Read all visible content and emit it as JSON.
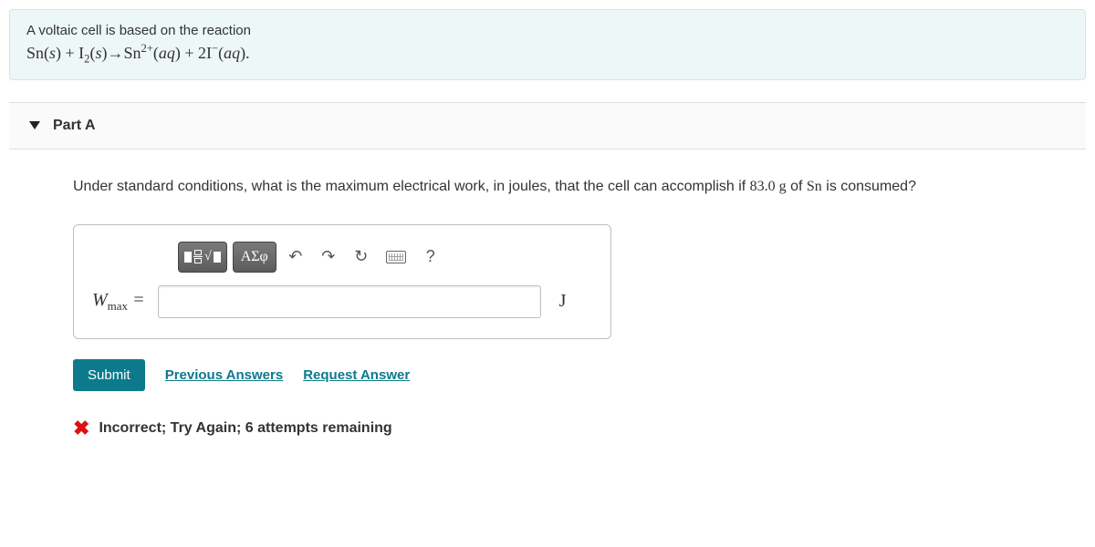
{
  "problem": {
    "intro": "A voltaic cell is based on the reaction",
    "reaction_html": "Sn(<span class='s'>s</span>) + I<sub>2</sub>(<span class='s'>s</span>)→Sn<sup>2+</sup>(<span class='s'>aq</span>) + 2I<sup>−</sup>(<span class='s'>aq</span>)."
  },
  "part": {
    "label": "Part A",
    "question_prefix": "Under standard conditions, what is the maximum electrical work, in joules, that the cell can accomplish if ",
    "question_value": "83.0 g",
    "question_mid": " of ",
    "question_species": "Sn",
    "question_suffix": " is consumed?"
  },
  "toolbar": {
    "template_label": "template",
    "symbols_label": "ΑΣφ",
    "undo": "↶",
    "redo": "↷",
    "reset": "↻",
    "help": "?"
  },
  "answer": {
    "variable": "W",
    "subscript": "max",
    "equals": " = ",
    "value": "",
    "unit": "J"
  },
  "actions": {
    "submit": "Submit",
    "previous": "Previous Answers",
    "request": "Request Answer"
  },
  "feedback": {
    "text": "Incorrect; Try Again; 6 attempts remaining"
  }
}
